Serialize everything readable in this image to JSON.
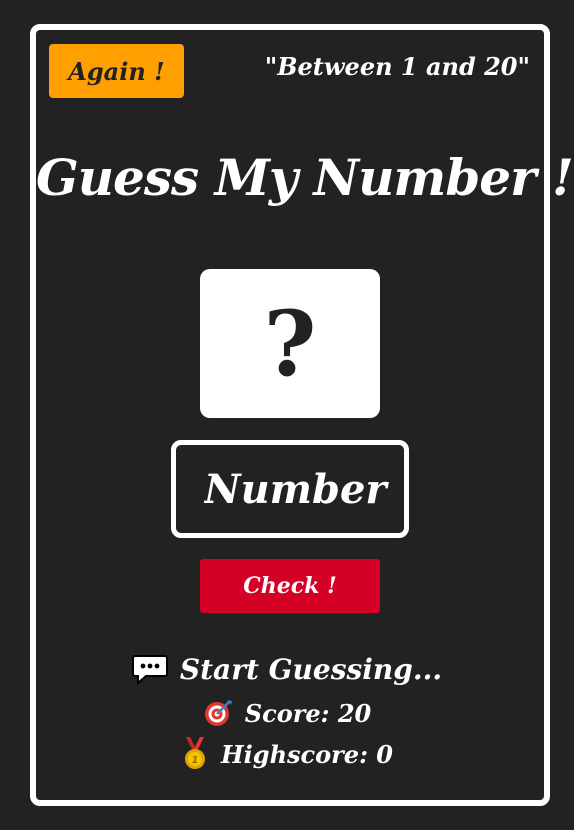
{
  "header": {
    "again_label": "Again !",
    "range_text": "\"Between 1 and 20\""
  },
  "main": {
    "title": "Guess My Number !",
    "secret_display": "?",
    "guess_placeholder": "Number",
    "check_label": "Check !"
  },
  "status": {
    "message": "Start Guessing...",
    "score_label": "Score: 20",
    "highscore_label": "Highscore: 0"
  },
  "icons": {
    "message": "speech-bubble-icon",
    "score": "target-icon",
    "highscore": "medal-icon"
  },
  "colors": {
    "background": "#222222",
    "again_button": "#ffa000",
    "check_button": "#d40025",
    "card_border": "#ffffff"
  }
}
